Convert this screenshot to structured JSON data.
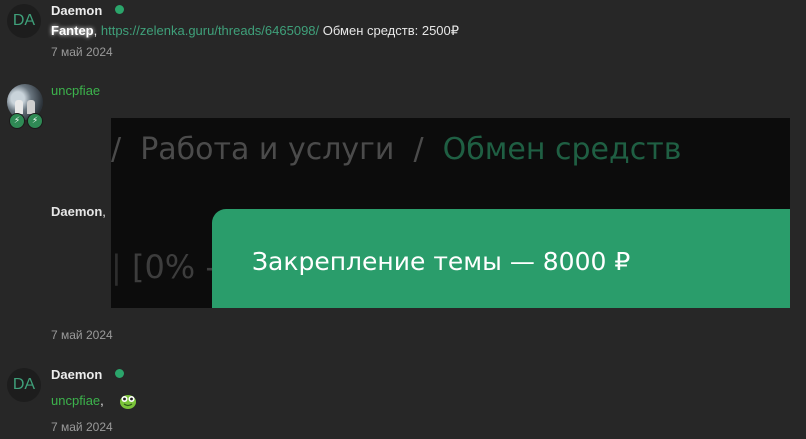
{
  "messages": [
    {
      "avatar_initials": "DA",
      "username": "Daemon",
      "mention": "Fantep",
      "separator": ",",
      "link": "https://zelenka.guru/threads/6465098/",
      "text": "Обмен средств: 2500₽",
      "time": "7 май 2024"
    },
    {
      "username": "uncpfiae",
      "badge_icon": "lightning-icon",
      "quote_author": "Daemon",
      "quote_sep": ",",
      "embed": {
        "crumb_sep1": "/",
        "crumb_1": "Работа и услуги",
        "crumb_sep2": "/",
        "crumb_2": "Обмен средств",
        "ghost_text": "[0% -",
        "price_text": "Закрепление темы — 8000 ₽"
      },
      "time": "7 май 2024"
    },
    {
      "avatar_initials": "DA",
      "username": "Daemon",
      "mention": "uncpfiae",
      "separator": ",",
      "sticker_icon": "frog-sticker-icon",
      "time": "7 май 2024"
    }
  ],
  "colors": {
    "background": "#272727",
    "accent_green": "#2a9d6b",
    "online": "#2ba56b",
    "link": "#3fa07a",
    "username_green": "#3cb34c"
  }
}
